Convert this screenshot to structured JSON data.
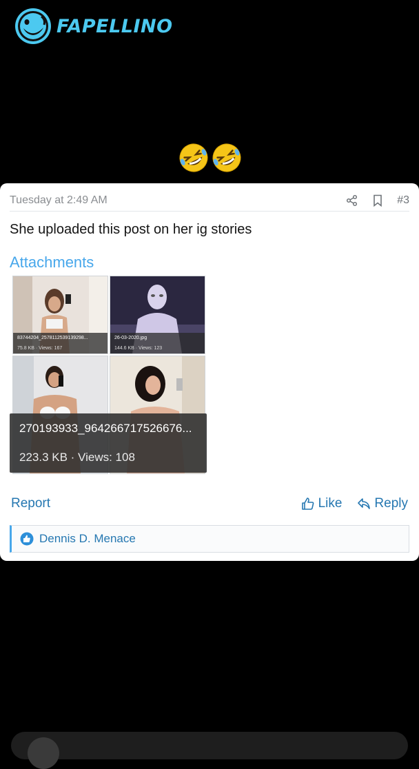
{
  "brand": {
    "name": "FAPELLINO",
    "color": "#4cc9f0"
  },
  "emojis": [
    "rolling-on-floor-laughing",
    "rolling-on-floor-laughing"
  ],
  "post": {
    "date": "Tuesday at 2:49 AM",
    "number": "#3",
    "body": "She uploaded this post on her ig stories",
    "attachments_title": "Attachments",
    "attachments": [
      {
        "name": "83744204_2578112539139298...",
        "meta": "75.8 KB · Views: 167"
      },
      {
        "name": "26-03-2020.jpg",
        "meta": "144.6 KB · Views: 123"
      },
      {
        "name": "270193933_964266717526676...",
        "meta": "223.3 KB · Views: 108"
      }
    ],
    "actions": {
      "report": "Report",
      "like": "Like",
      "reply": "Reply"
    },
    "likes": {
      "name": "Dennis D. Menace"
    }
  },
  "colors": {
    "link": "#2577b1",
    "accent": "#47a7eb",
    "background": "#000000"
  }
}
